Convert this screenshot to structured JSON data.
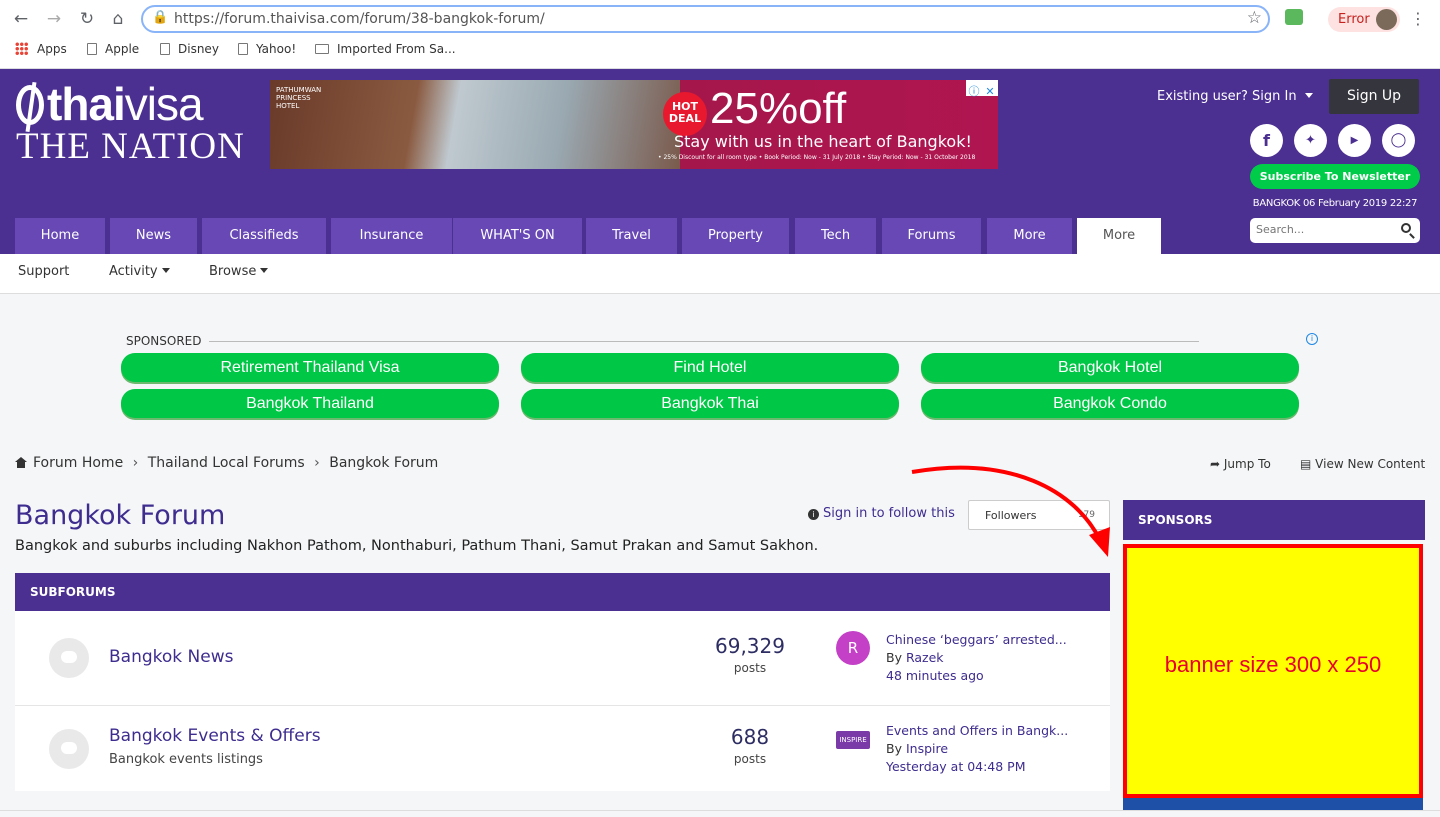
{
  "browser": {
    "url": "https://forum.thaivisa.com/forum/38-bangkok-forum/",
    "error_label": "Error",
    "bookmarks": [
      "Apps",
      "Apple",
      "Disney",
      "Yahoo!",
      "Imported From Sa..."
    ]
  },
  "header": {
    "logo_line1_bold": "thai",
    "logo_line1_light": "visa",
    "logo_line2": "THE NATION",
    "ad": {
      "brand": "PATHUMWAN PRINCESS HOTEL",
      "hot_deal": "HOT DEAL",
      "headline": "25%off",
      "subline": "Stay with us in the heart of Bangkok!",
      "fine_print": "• 25% Discount for all room type   • Book Period: Now - 31 July 2018   • Stay Period: Now - 31 October 2018"
    },
    "signin_label": "Existing user? Sign In",
    "signup_label": "Sign Up",
    "subscribe_label": "Subscribe To Newsletter",
    "datetime": "BANGKOK 06 February 2019 22:27",
    "search_placeholder": "Search...",
    "socials": [
      "facebook-icon",
      "twitter-icon",
      "youtube-icon",
      "instagram-icon"
    ]
  },
  "nav": {
    "tabs": [
      "Home",
      "News",
      "Classifieds",
      "Insurance",
      "WHAT'S ON",
      "Travel",
      "Property",
      "Tech",
      "Forums",
      "More",
      "More"
    ],
    "subnav": [
      "Support",
      "Activity",
      "Browse"
    ]
  },
  "sponsored": {
    "label": "SPONSORED",
    "links": [
      "Retirement Thailand Visa",
      "Find Hotel",
      "Bangkok Hotel",
      "Bangkok Thailand",
      "Bangkok Thai",
      "Bangkok Condo"
    ]
  },
  "breadcrumb": [
    "Forum Home",
    "Thailand Local Forums",
    "Bangkok Forum"
  ],
  "actions": {
    "jump_to": "Jump To",
    "view_new": "View New Content"
  },
  "forum": {
    "title": "Bangkok Forum",
    "description": "Bangkok and suburbs including Nakhon Pathom, Nonthaburi, Pathum Thani, Samut Prakan and Samut Sakhon.",
    "follow_label": "Sign in to follow this",
    "followers_label": "Followers",
    "followers_count": "179"
  },
  "subforums": {
    "header": "SUBFORUMS",
    "items": [
      {
        "name": "Bangkok News",
        "subtitle": "",
        "posts": "69,329",
        "posts_label": "posts",
        "avatar": "R",
        "last_title": "Chinese ‘beggars’ arrested...",
        "last_by_prefix": "By",
        "last_by": "Razek",
        "last_time": "48 minutes ago"
      },
      {
        "name": "Bangkok Events & Offers",
        "subtitle": "Bangkok events listings",
        "posts": "688",
        "posts_label": "posts",
        "avatar": "INSPIRE",
        "last_title": "Events and Offers in Bangk...",
        "last_by_prefix": "By",
        "last_by": "Inspire",
        "last_time": "Yesterday at 04:48 PM"
      }
    ]
  },
  "sidebar": {
    "header": "SPONSORS",
    "banner_text": "banner size 300 x 250"
  },
  "colors": {
    "brand_purple": "#4b2f91",
    "tab_purple": "#6748b5",
    "green": "#00c746",
    "banner_yellow": "#ffff00",
    "banner_red": "#ff0000"
  }
}
